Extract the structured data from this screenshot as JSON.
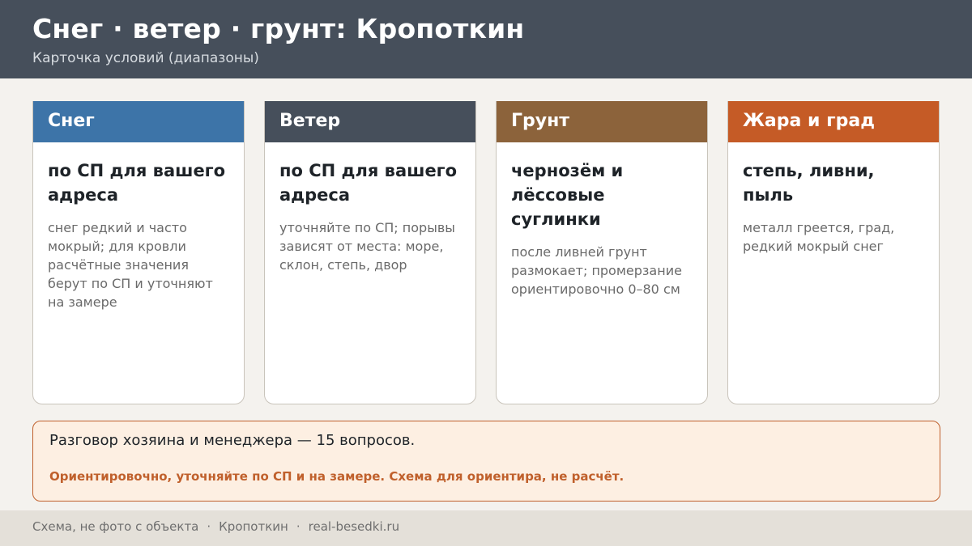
{
  "header": {
    "title": "Снег · ветер · грунт: Кропоткин",
    "subtitle": "Карточка условий (диапазоны)"
  },
  "cards": [
    {
      "label": "Снег",
      "color": "#3d74a8",
      "headline": "по СП для вашего адреса",
      "note": "снег редкий и часто мокрый; для кровли расчётные значения берут по СП и уточняют на замере"
    },
    {
      "label": "Ветер",
      "color": "#464f5b",
      "headline": "по СП для вашего адреса",
      "note": "уточняйте по СП; порывы зависят от места: море, склон, степь, двор"
    },
    {
      "label": "Грунт",
      "color": "#8c633b",
      "headline": "чернозём и лёссовые суглинки",
      "note": "после ливней грунт размокает; промерзание ориентировочно 0–80 см"
    },
    {
      "label": "Жара и град",
      "color": "#c55b26",
      "headline": "степь, ливни, пыль",
      "note": "металл греется, град, редкий мокрый снег"
    }
  ],
  "notice": {
    "line1": "Разговор хозяина и менеджера — 15 вопросов.",
    "line2": "Ориентировочно, уточняйте по СП и на замере. Схема для ориентира, не расчёт."
  },
  "footer": {
    "part1": "Схема, не фото с объекта",
    "sep": "·",
    "part2": "Кропоткин",
    "part3": "real-besedki.ru"
  }
}
